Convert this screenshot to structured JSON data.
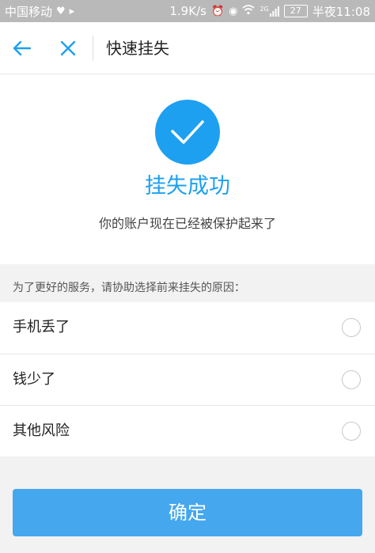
{
  "status_bar": {
    "carrier": "中国移动",
    "speed": "1.9K/s",
    "signal_label": "2G",
    "battery": "27",
    "time": "半夜11:08",
    "icons": [
      "heart-icon",
      "play-icon",
      "alarm-icon",
      "eye-icon",
      "wifi-icon",
      "signal-icon",
      "battery-icon"
    ]
  },
  "nav": {
    "title": "快速挂失",
    "back_icon": "arrow-left-icon",
    "close_icon": "close-icon",
    "accent": "#1ea0f0"
  },
  "result": {
    "icon": "check-circle-icon",
    "title": "挂失成功",
    "subtitle": "你的账户现在已经被保护起来了"
  },
  "reasons": {
    "prompt": "为了更好的服务，请协助选择前来挂失的原因：",
    "options": [
      {
        "label": "手机丢了",
        "selected": false
      },
      {
        "label": "钱少了",
        "selected": false
      },
      {
        "label": "其他风险",
        "selected": false
      }
    ]
  },
  "confirm_button": {
    "label": "确定",
    "color": "#45a7ee"
  }
}
